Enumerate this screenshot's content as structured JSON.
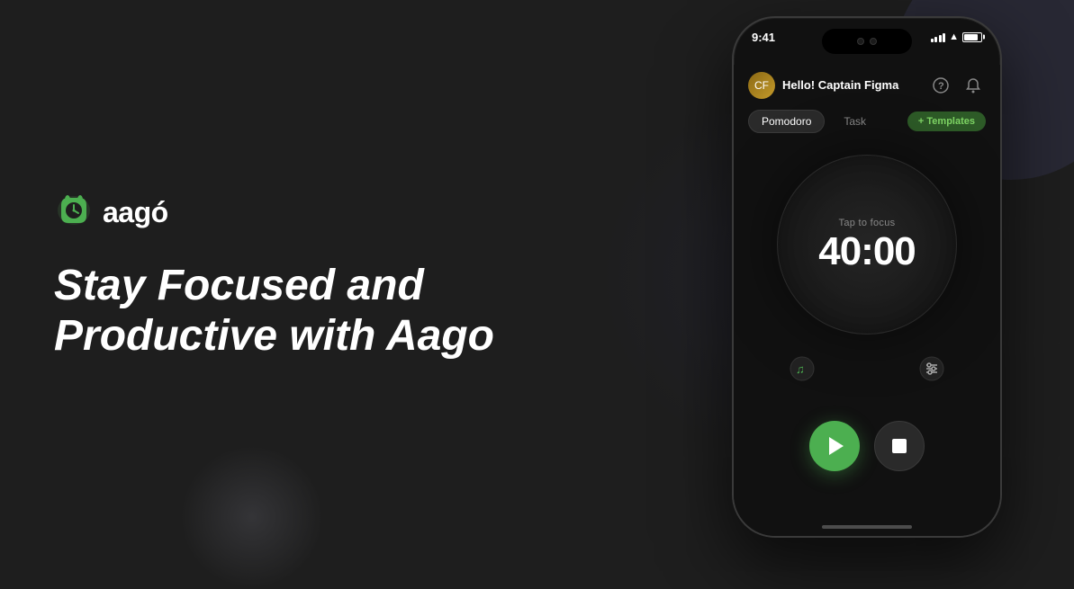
{
  "app": {
    "background_color": "#1e1e1e"
  },
  "logo": {
    "text": "aagó",
    "icon_alt": "aago-logo-icon"
  },
  "headline": {
    "line1": "Stay Focused and",
    "line2": "Productive with Aago"
  },
  "phone": {
    "status_bar": {
      "time": "9:41"
    },
    "header": {
      "greeting_prefix": "Hello!",
      "username": "Captain Figma"
    },
    "tabs": [
      {
        "label": "Pomodoro",
        "active": true
      },
      {
        "label": "Task",
        "active": false
      }
    ],
    "templates_button": "+ Templates",
    "timer": {
      "tap_label": "Tap to focus",
      "display": "40:00"
    },
    "controls": {
      "music_icon": "🎵",
      "settings_icon": "⚙"
    },
    "actions": {
      "play_label": "Play",
      "stop_label": "Stop"
    }
  }
}
